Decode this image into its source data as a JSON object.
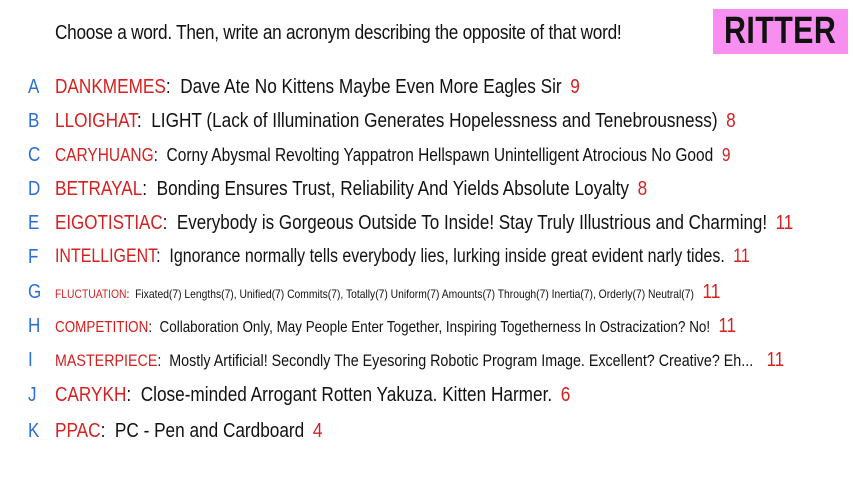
{
  "prompt": "Choose a word. Then, write an acronym describing the opposite of that word!",
  "name_badge": "RITTER",
  "colors": {
    "letter": "#2b6fd6",
    "word": "#d62020",
    "score": "#d62020",
    "badge_background": "#f78ef0"
  },
  "entries": [
    {
      "letter": "A",
      "word": "DANKMEMES",
      "acronym": "Dave Ate No Kittens Maybe Even More Eagles Sir",
      "score": "9"
    },
    {
      "letter": "B",
      "word": "LLOIGHAT",
      "acronym": "LIGHT (Lack of Illumination Generates Hopelessness and Tenebrousness)",
      "score": "8"
    },
    {
      "letter": "C",
      "word": "CARYHUANG",
      "acronym": "Corny Abysmal Revolting Yappatron Hellspawn Unintelligent Atrocious No Good",
      "score": "9"
    },
    {
      "letter": "D",
      "word": "BETRAYAL",
      "acronym": "Bonding Ensures Trust, Reliability And Yields Absolute Loyalty",
      "score": "8"
    },
    {
      "letter": "E",
      "word": "EIGOTISTIAC",
      "acronym": "Everybody is Gorgeous Outside To Inside! Stay Truly Illustrious and Charming!",
      "score": "11"
    },
    {
      "letter": "F",
      "word": "INTELLIGENT",
      "acronym": "Ignorance normally tells everybody lies, lurking inside great evident narly tides.",
      "score": "11"
    },
    {
      "letter": "G",
      "word": "FLUCTUATION",
      "acronym": "Fixated(7) Lengths(7), Unified(7) Commits(7), Totally(7) Uniform(7) Amounts(7) Through(7) Inertia(7), Orderly(7) Neutral(7)",
      "score": "11"
    },
    {
      "letter": "H",
      "word": "COMPETITION",
      "acronym": "Collaboration Only, May People Enter Together, Inspiring Togetherness In Ostracization? No!",
      "score": "11"
    },
    {
      "letter": "I",
      "word": "MASTERPIECE",
      "acronym": "Mostly Artificial! Secondly The Eyesoring Robotic Program Image. Excellent? Creative? Eh...",
      "score": "11"
    },
    {
      "letter": "J",
      "word": "CARYKH",
      "acronym": "Close-minded Arrogant Rotten Yakuza. Kitten Harmer.",
      "score": "6"
    },
    {
      "letter": "K",
      "word": "PPAC",
      "acronym": "PC - Pen and Cardboard",
      "score": "4"
    }
  ]
}
